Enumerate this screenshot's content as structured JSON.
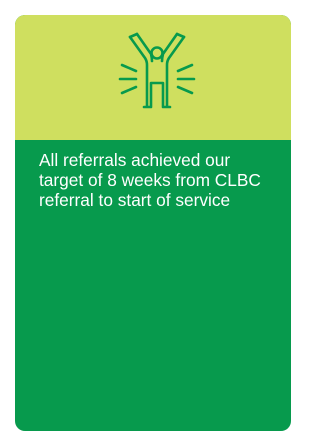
{
  "card": {
    "header": {
      "background_color": "#cfdf5f",
      "icon": "person-celebrating-icon",
      "icon_color": "#079a4d"
    },
    "body": {
      "background_color": "#079a4d",
      "text": "All referrals achieved our target of 8 weeks from CLBC referral to start of service",
      "text_color": "#ffffff"
    }
  }
}
